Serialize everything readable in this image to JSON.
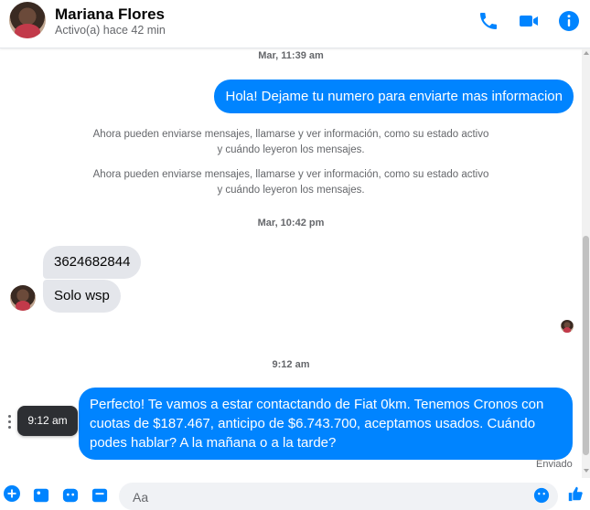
{
  "contact": {
    "name": "Mariana Flores",
    "status": "Activo(a) hace 42 min"
  },
  "header_icons": [
    "phone-icon",
    "video-icon",
    "info-icon"
  ],
  "colors": {
    "accent": "#0084ff",
    "incoming_bubble": "#e4e6eb",
    "muted_text": "#65676b"
  },
  "thread": {
    "ts1": "Mar, 11:39 am",
    "msg_out_1": "Hola! Dejame tu numero para enviarte mas informacion",
    "notice1": "Ahora pueden enviarse mensajes, llamarse y ver información, como su estado activo y cuándo leyeron los mensajes.",
    "notice2": "Ahora pueden enviarse mensajes, llamarse y ver información, como su estado activo y cuándo leyeron los mensajes.",
    "ts2": "Mar, 10:42 pm",
    "msg_in_1": "3624682844",
    "msg_in_2": "Solo wsp",
    "ts3": "9:12 am",
    "msg_out_2": "Perfecto! Te vamos a estar contactando de Fiat 0km. Tenemos Cronos con cuotas de $187.467, anticipo de $6.743.700, aceptamos usados. Cuándo podes hablar? A la mañana o a la tarde?",
    "tooltip": "9:12 am",
    "sent_status": "Enviado"
  },
  "composer": {
    "placeholder": "Aa"
  }
}
